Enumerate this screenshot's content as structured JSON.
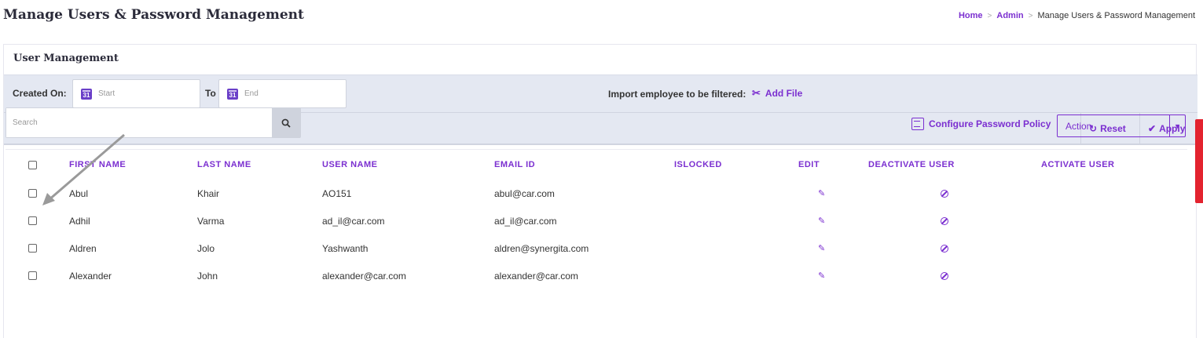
{
  "page": {
    "title": "Manage Users & Password Management"
  },
  "breadcrumb": {
    "home": "Home",
    "admin": "Admin",
    "current": "Manage Users & Password Management",
    "separator": ">"
  },
  "card": {
    "title": "User Management"
  },
  "filters": {
    "created_on_label": "Created On:",
    "start_placeholder": "Start",
    "to_label": "To",
    "end_placeholder": "End",
    "calendar_icon_text": "31",
    "import_label": "Import employee to be filtered:",
    "add_file_label": "Add File",
    "reset_label": "Reset",
    "apply_label": "Apply"
  },
  "toolbar": {
    "search_placeholder": "Search",
    "configure_policy_label": "Configure Password Policy",
    "action_value": "Action"
  },
  "table": {
    "headers": [
      "FIRST NAME",
      "LAST NAME",
      "USER NAME",
      "EMAIL ID",
      "ISLOCKED",
      "EDIT",
      "DEACTIVATE USER",
      "ACTIVATE USER"
    ],
    "rows": [
      {
        "first": "Abul",
        "last": "Khair",
        "user": "AO151",
        "email": "abul@car.com",
        "locked": ""
      },
      {
        "first": "Adhil",
        "last": "Varma",
        "user": "ad_il@car.com",
        "email": "ad_il@car.com",
        "locked": ""
      },
      {
        "first": "Aldren",
        "last": "Jolo",
        "user": "Yashwanth",
        "email": "aldren@synergita.com",
        "locked": ""
      },
      {
        "first": "Alexander",
        "last": "John",
        "user": "alexander@car.com",
        "email": "alexander@car.com",
        "locked": ""
      }
    ]
  },
  "colors": {
    "accent": "#7b2fd0",
    "filter_bg": "#e4e8f2",
    "side_tab": "#e3232f"
  },
  "icons": [
    "calendar-icon",
    "paperclip-icon",
    "reset-icon",
    "apply-check-icon",
    "search-icon",
    "policy-icon",
    "chevron-down-icon",
    "edit-icon",
    "deactivate-icon"
  ]
}
